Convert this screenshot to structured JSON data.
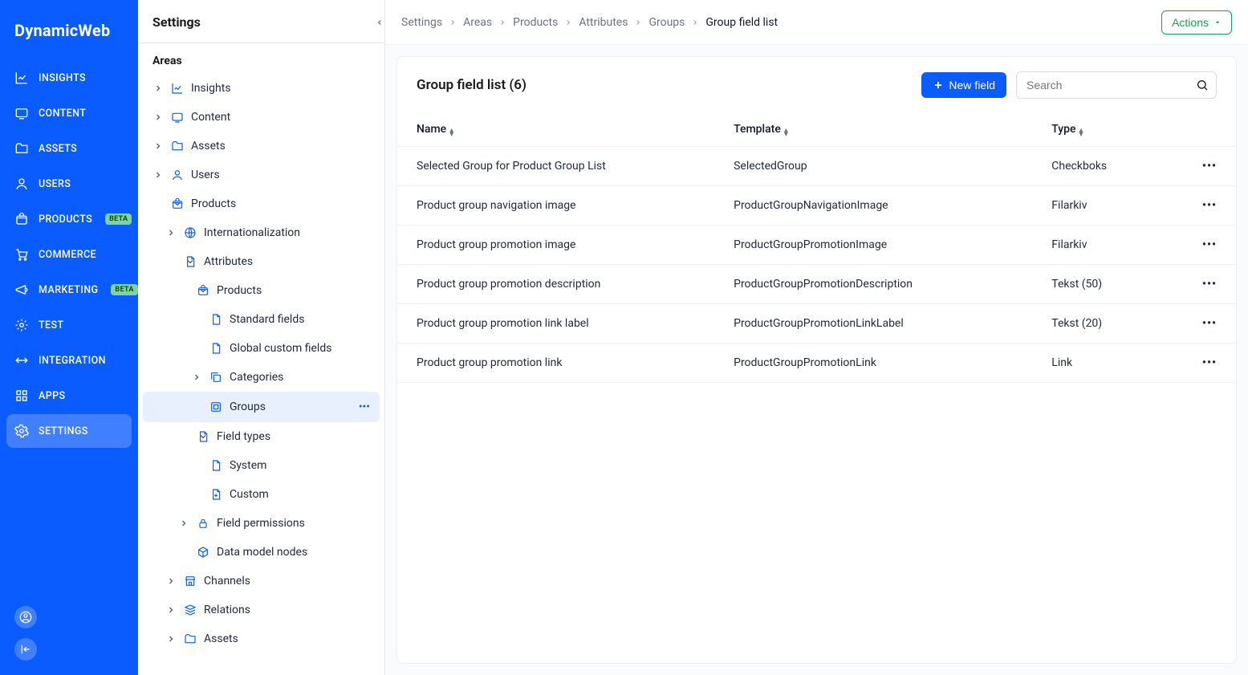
{
  "logo": "DynamicWeb",
  "primary_nav": {
    "items": [
      {
        "label": "INSIGHTS",
        "badge": null
      },
      {
        "label": "CONTENT",
        "badge": null
      },
      {
        "label": "ASSETS",
        "badge": null
      },
      {
        "label": "USERS",
        "badge": null
      },
      {
        "label": "PRODUCTS",
        "badge": "BETA"
      },
      {
        "label": "COMMERCE",
        "badge": null
      },
      {
        "label": "MARKETING",
        "badge": "BETA"
      },
      {
        "label": "TEST",
        "badge": null
      },
      {
        "label": "INTEGRATION",
        "badge": null
      },
      {
        "label": "APPS",
        "badge": null
      },
      {
        "label": "SETTINGS",
        "badge": null
      }
    ],
    "active_index": 10
  },
  "secondary": {
    "header": "Settings",
    "section": "Areas",
    "tree": [
      {
        "label": "Insights",
        "depth": 0,
        "caret": "right",
        "icon": "insights"
      },
      {
        "label": "Content",
        "depth": 0,
        "caret": "right",
        "icon": "content"
      },
      {
        "label": "Assets",
        "depth": 0,
        "caret": "right",
        "icon": "folder"
      },
      {
        "label": "Users",
        "depth": 0,
        "caret": "right",
        "icon": "user"
      },
      {
        "label": "Products",
        "depth": 0,
        "caret": "down",
        "icon": "products"
      },
      {
        "label": "Internationalization",
        "depth": 1,
        "caret": "right",
        "icon": "globe"
      },
      {
        "label": "Attributes",
        "depth": 1,
        "caret": "down",
        "icon": "file"
      },
      {
        "label": "Products",
        "depth": 2,
        "caret": "down",
        "icon": "products"
      },
      {
        "label": "Standard fields",
        "depth": 3,
        "caret": "none",
        "icon": "file"
      },
      {
        "label": "Global custom fields",
        "depth": 3,
        "caret": "none",
        "icon": "file"
      },
      {
        "label": "Categories",
        "depth": 3,
        "caret": "right",
        "icon": "copy"
      },
      {
        "label": "Groups",
        "depth": 3,
        "caret": "none",
        "icon": "group",
        "selected": true,
        "more": true
      },
      {
        "label": "Field types",
        "depth": 2,
        "caret": "down",
        "icon": "file"
      },
      {
        "label": "System",
        "depth": 3,
        "caret": "none",
        "icon": "file"
      },
      {
        "label": "Custom",
        "depth": 3,
        "caret": "none",
        "icon": "file-plus"
      },
      {
        "label": "Field permissions",
        "depth": 2,
        "caret": "right",
        "icon": "lock"
      },
      {
        "label": "Data model nodes",
        "depth": 2,
        "caret": "none",
        "icon": "cube"
      },
      {
        "label": "Channels",
        "depth": 1,
        "caret": "right",
        "icon": "store"
      },
      {
        "label": "Relations",
        "depth": 1,
        "caret": "right",
        "icon": "stack"
      },
      {
        "label": "Assets",
        "depth": 1,
        "caret": "right",
        "icon": "folder"
      }
    ]
  },
  "breadcrumb": [
    "Settings",
    "Areas",
    "Products",
    "Attributes",
    "Groups",
    "Group field list"
  ],
  "actions_label": "Actions",
  "card": {
    "title": "Group field list (6)",
    "new_button": "New field",
    "search_placeholder": "Search",
    "columns": [
      "Name",
      "Template",
      "Type"
    ],
    "rows": [
      {
        "name": "Selected Group for Product Group List",
        "template": "SelectedGroup",
        "type": "Checkboks"
      },
      {
        "name": "Product group navigation image",
        "template": "ProductGroupNavigationImage",
        "type": "Filarkiv"
      },
      {
        "name": "Product group promotion image",
        "template": "ProductGroupPromotionImage",
        "type": "Filarkiv"
      },
      {
        "name": "Product group promotion description",
        "template": "ProductGroupPromotionDescription",
        "type": "Tekst (50)"
      },
      {
        "name": "Product group promotion link label",
        "template": "ProductGroupPromotionLinkLabel",
        "type": "Tekst (20)"
      },
      {
        "name": "Product group promotion link",
        "template": "ProductGroupPromotionLink",
        "type": "Link"
      }
    ]
  }
}
